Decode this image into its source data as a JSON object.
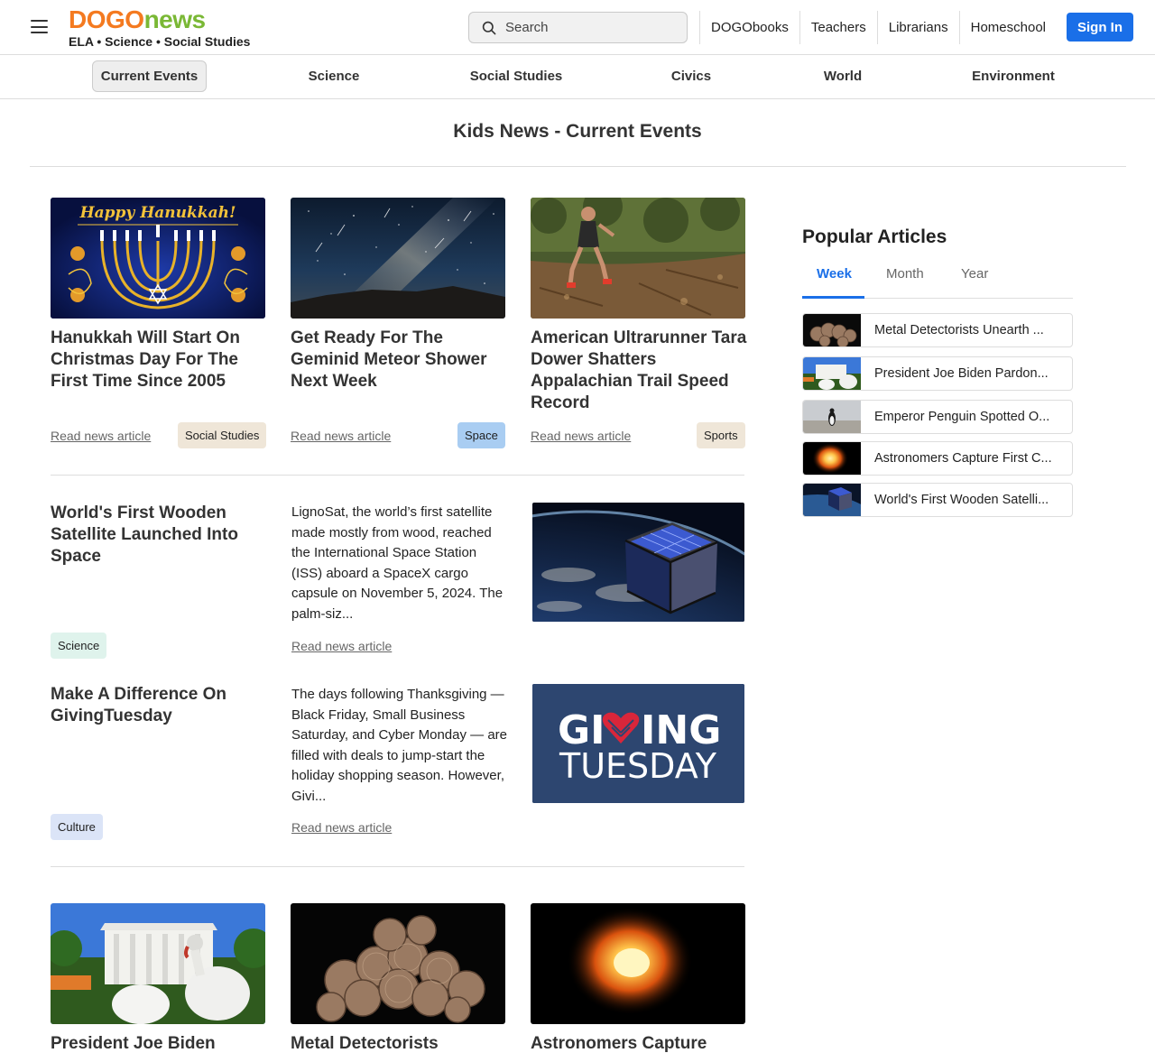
{
  "header": {
    "logo_dogo": "DOGO",
    "logo_news": "news",
    "tagline": "ELA • Science • Social Studies",
    "search_placeholder": "Search",
    "nav": [
      "DOGObooks",
      "Teachers",
      "Librarians",
      "Homeschool"
    ],
    "signin_label": "Sign In"
  },
  "categories": [
    "Current Events",
    "Science",
    "Social Studies",
    "Civics",
    "World",
    "Environment"
  ],
  "active_category": "Current Events",
  "page_title": "Kids News - Current Events",
  "read_link_label": "Read news article",
  "grid_top": [
    {
      "title": "Hanukkah Will Start On Christmas Day For The First Time Since 2005",
      "tag": "Social Studies",
      "tag_color": "#efe6d8",
      "image": "hanukkah-menorah"
    },
    {
      "title": "Get Ready For The Geminid Meteor Shower Next Week",
      "tag": "Space",
      "tag_color": "#a9cdf2",
      "image": "meteor-night-sky"
    },
    {
      "title": "American Ultrarunner Tara Dower Shatters Appalachian Trail Speed Record",
      "tag": "Sports",
      "tag_color": "#efe6d8",
      "image": "runner-forest"
    }
  ],
  "featured": [
    {
      "title": "World's First Wooden Satellite Launched Into Space",
      "excerpt": "LignoSat, the world’s first satellite made mostly from wood, reached the International Space Station (ISS) aboard a SpaceX cargo capsule on November 5, 2024. The palm-siz...",
      "tag": "Science",
      "tag_color": "#dff3ec",
      "image": "wooden-satellite"
    },
    {
      "title": "Make A Difference On GivingTuesday",
      "excerpt": "The days following Thanksgiving — Black Friday, Small Business Saturday, and Cyber Monday — are filled with deals to jump-start the holiday shopping season. However, Givi...",
      "tag": "Culture",
      "tag_color": "#dbe4f7",
      "image": "giving-tuesday-logo",
      "logo_line1_a": "GI",
      "logo_line1_b": "ING",
      "logo_line2": "TUESDAY"
    }
  ],
  "grid_bottom": [
    {
      "title": "President Joe Biden",
      "image": "turkeys-white-house"
    },
    {
      "title": "Metal Detectorists Unearth",
      "image": "silver-coins"
    },
    {
      "title": "Astronomers Capture First",
      "image": "star-glow"
    }
  ],
  "sidebar": {
    "title": "Popular Articles",
    "tabs": [
      "Week",
      "Month",
      "Year"
    ],
    "active_tab": "Week",
    "items": [
      {
        "text": "Metal Detectorists Unearth ...",
        "image": "silver-coins"
      },
      {
        "text": "President Joe Biden Pardon...",
        "image": "turkeys-white-house"
      },
      {
        "text": "Emperor Penguin Spotted O...",
        "image": "penguin-beach"
      },
      {
        "text": "Astronomers Capture First C...",
        "image": "star-glow"
      },
      {
        "text": "World's First Wooden Satelli...",
        "image": "wooden-satellite"
      }
    ]
  },
  "colors": {
    "brand_orange": "#f47a20",
    "brand_green": "#7ab835",
    "accent_blue": "#1a6fe8"
  }
}
